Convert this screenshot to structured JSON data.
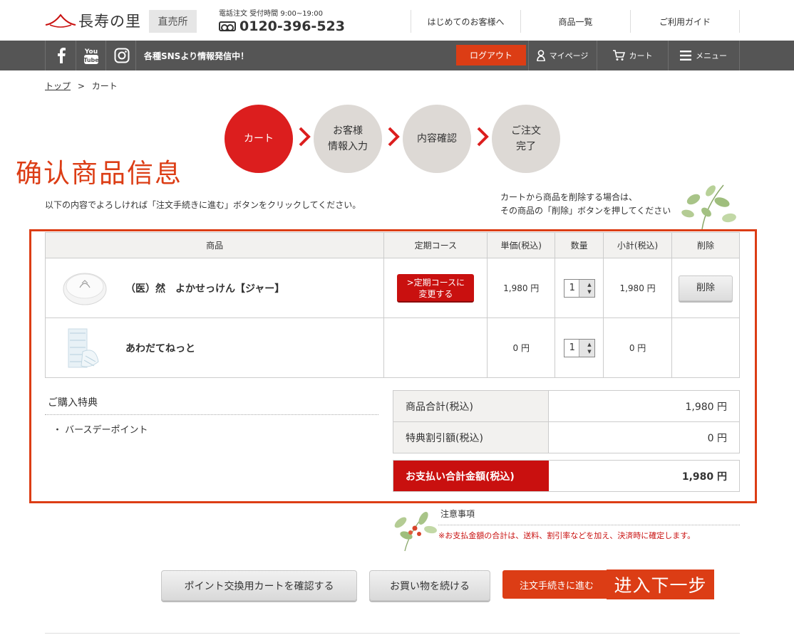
{
  "header": {
    "logo_text": "長寿の里",
    "store_badge": "直売所",
    "phone_label": "電話注文 受付時間 9:00~19:00",
    "phone_number": "0120-396-523",
    "nav": [
      "はじめてのお客様へ",
      "商品一覧",
      "ご利用ガイド"
    ]
  },
  "darkbar": {
    "sns_message": "各種SNSより情報発信中！",
    "logout": "ログアウト",
    "mypage": "マイページ",
    "cart": "カート",
    "menu": "メニュー"
  },
  "breadcrumb": {
    "top": "トップ",
    "sep": ">",
    "current": "カート"
  },
  "steps": [
    {
      "label": "カート",
      "active": true
    },
    {
      "label": "お客様\n情報入力",
      "active": false
    },
    {
      "label": "内容確認",
      "active": false
    },
    {
      "label": "ご注文\n完了",
      "active": false
    }
  ],
  "annotations": {
    "confirm": "确认商品信息",
    "next": "进入下一步"
  },
  "intro_text": "以下の内容でよろしければ「注文手続きに進む」ボタンをクリックしてください。",
  "delete_note": [
    "カートから商品を削除する場合は、",
    "その商品の「削除」ボタンを押してください"
  ],
  "table": {
    "headers": [
      "商品",
      "定期コース",
      "単価(税込)",
      "数量",
      "小計(税込)",
      "削除"
    ],
    "rows": [
      {
        "name": "（医）然　よかせっけん【ジャー】",
        "course_button": ">定期コースに\n変更する",
        "price": "1,980 円",
        "qty": "1",
        "subtotal": "1,980 円",
        "delete": "削除"
      },
      {
        "name": "あわだてねっと",
        "course_button": "",
        "price": "0 円",
        "qty": "1",
        "subtotal": "0 円",
        "delete": ""
      }
    ]
  },
  "perks": {
    "title": "ご購入特典",
    "items": [
      "・ バースデーポイント"
    ]
  },
  "summary": {
    "rows": [
      {
        "label": "商品合計(税込)",
        "value": "1,980 円"
      },
      {
        "label": "特典割引額(税込)",
        "value": "0 円"
      }
    ],
    "total_label": "お支払い合計金額(税込)",
    "total_value": "1,980 円"
  },
  "notes": {
    "title": "注意事項",
    "text": "※お支払金額の合計は、送料、割引率などを加え、決済時に確定します。"
  },
  "buttons": {
    "points_cart": "ポイント交換用カートを確認する",
    "continue": "お買い物を続ける",
    "proceed": "注文手続きに進む"
  },
  "colors": {
    "brand_red": "#c9100f",
    "accent_orange": "#dc3d15",
    "dark_bar": "#555555"
  }
}
